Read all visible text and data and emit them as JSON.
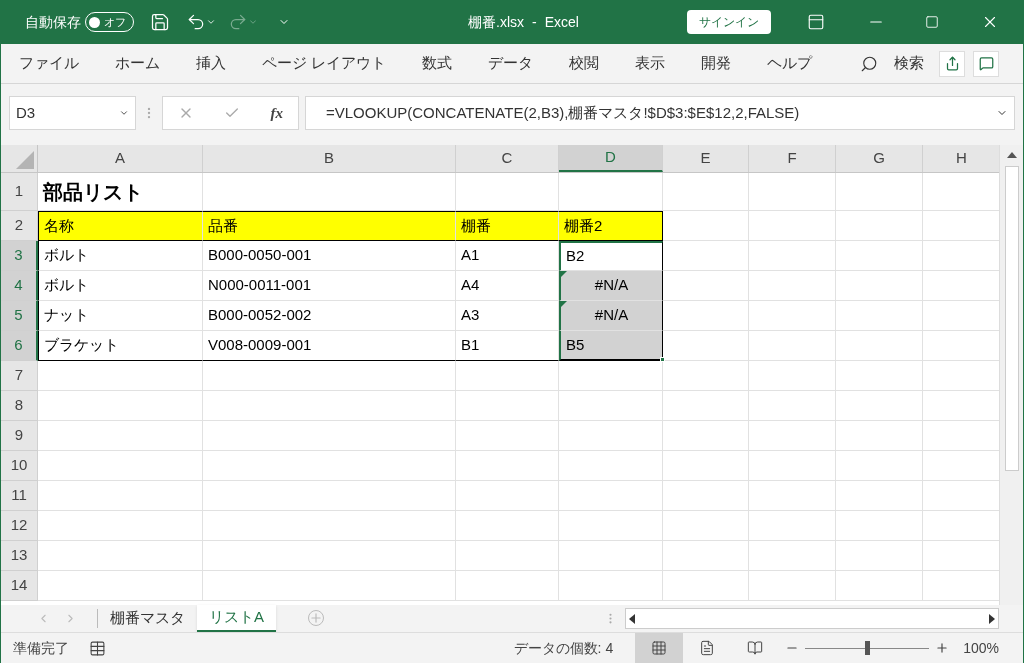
{
  "title_bar": {
    "autosave_label": "自動保存",
    "autosave_toggle": {
      "label": "オフ",
      "on": false
    },
    "filename": "棚番.xlsx",
    "separator": "-",
    "app_name": "Excel",
    "signin": "サインイン"
  },
  "ribbon_tabs": [
    "ファイル",
    "ホーム",
    "挿入",
    "ページ レイアウト",
    "数式",
    "データ",
    "校閲",
    "表示",
    "開発",
    "ヘルプ"
  ],
  "search": {
    "label": "検索"
  },
  "name_box": "D3",
  "function_label": "fx",
  "formula": "=VLOOKUP(CONCATENATE(2,B3),棚番マスタ!$D$3:$E$12,2,FALSE)",
  "columns": [
    {
      "label": "A",
      "selected": false
    },
    {
      "label": "B",
      "selected": false
    },
    {
      "label": "C",
      "selected": false
    },
    {
      "label": "D",
      "selected": true
    },
    {
      "label": "E",
      "selected": false
    },
    {
      "label": "F",
      "selected": false
    },
    {
      "label": "G",
      "selected": false
    },
    {
      "label": "H",
      "selected": false
    }
  ],
  "rows": [
    {
      "number": "1",
      "kind": "title",
      "selected": false,
      "cells": [
        {
          "text": "部品リスト",
          "selected": false
        }
      ]
    },
    {
      "number": "2",
      "kind": "header",
      "selected": false,
      "cells": [
        {
          "text": "名称",
          "selected": false
        },
        {
          "text": "品番",
          "selected": false
        },
        {
          "text": "棚番",
          "selected": false
        },
        {
          "text": "棚番2",
          "selected": false
        }
      ]
    },
    {
      "number": "3",
      "kind": "data",
      "selected": true,
      "cells": [
        {
          "text": "ボルト",
          "selected": false
        },
        {
          "text": "B000-0050-001",
          "selected": false
        },
        {
          "text": "A1",
          "selected": false
        },
        {
          "text": "B2",
          "selected": true,
          "active": true,
          "error_flag": false
        }
      ]
    },
    {
      "number": "4",
      "kind": "data",
      "selected": true,
      "cells": [
        {
          "text": "ボルト",
          "selected": false
        },
        {
          "text": "N000-0011-001",
          "selected": false
        },
        {
          "text": "A4",
          "selected": false
        },
        {
          "text": "#N/A",
          "selected": true,
          "active": false,
          "error_flag": true
        }
      ]
    },
    {
      "number": "5",
      "kind": "data",
      "selected": true,
      "cells": [
        {
          "text": "ナット",
          "selected": false
        },
        {
          "text": "B000-0052-002",
          "selected": false
        },
        {
          "text": "A3",
          "selected": false
        },
        {
          "text": "#N/A",
          "selected": true,
          "active": false,
          "error_flag": true
        }
      ]
    },
    {
      "number": "6",
      "kind": "data",
      "selected": true,
      "cells": [
        {
          "text": "ブラケット",
          "selected": false
        },
        {
          "text": "V008-0009-001",
          "selected": false
        },
        {
          "text": "B1",
          "selected": false
        },
        {
          "text": "B5",
          "selected": true,
          "active": false,
          "error_flag": false
        }
      ]
    },
    {
      "number": "7",
      "kind": "empty",
      "selected": false,
      "cells": []
    },
    {
      "number": "8",
      "kind": "empty",
      "selected": false,
      "cells": []
    },
    {
      "number": "9",
      "kind": "empty",
      "selected": false,
      "cells": []
    },
    {
      "number": "10",
      "kind": "empty",
      "selected": false,
      "cells": []
    },
    {
      "number": "11",
      "kind": "empty",
      "selected": false,
      "cells": []
    },
    {
      "number": "12",
      "kind": "empty",
      "selected": false,
      "cells": []
    },
    {
      "number": "13",
      "kind": "empty",
      "selected": false,
      "cells": []
    },
    {
      "number": "14",
      "kind": "empty",
      "selected": false,
      "cells": []
    }
  ],
  "sheet_tabs": [
    {
      "label": "棚番マスタ",
      "selected": false
    },
    {
      "label": "リストA",
      "selected": true
    }
  ],
  "status_bar": {
    "ready": "準備完了",
    "count": "データの個数: 4",
    "views": [
      {
        "kind": "normal",
        "selected": true
      },
      {
        "kind": "page_layout",
        "selected": false
      },
      {
        "kind": "page_break",
        "selected": false
      }
    ],
    "zoom": {
      "level": 0.5,
      "reading": "100%"
    }
  }
}
